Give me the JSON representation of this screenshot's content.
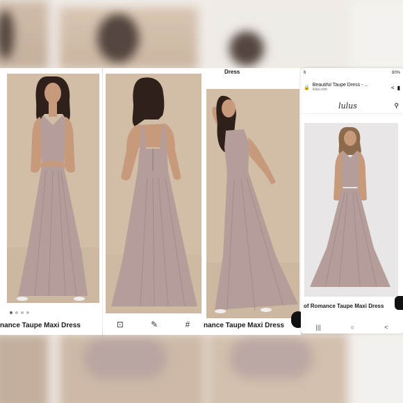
{
  "panel_a": {
    "product_title": "nance Taupe Maxi Dress"
  },
  "panel_c": {
    "product_title": "nance Taupe Maxi Dress",
    "top_text": "Dress"
  },
  "panel_b": {
    "toolbar": [
      {
        "icon": "scan-icon",
        "glyph": "⊡"
      },
      {
        "icon": "edit-icon",
        "glyph": "✎"
      },
      {
        "icon": "hashtag-icon",
        "glyph": "#"
      }
    ]
  },
  "phone": {
    "status_time": "6",
    "status_right": "80%",
    "page_title": "Beautiful Taupe Dress - ...",
    "domain": "lulus.com",
    "logo": "lulus",
    "product_title": "of Romance Taupe Maxi Dress",
    "nav": [
      {
        "icon": "recents-icon",
        "glyph": "|||"
      },
      {
        "icon": "home-icon",
        "glyph": "○"
      },
      {
        "icon": "back-icon",
        "glyph": "<"
      }
    ]
  },
  "colors": {
    "dress": "#b59e99",
    "studio_bg": "#d2bda6",
    "phone_bg": "#e9e6e8",
    "hair": "#2f2019",
    "skin": "#c89a7c"
  }
}
